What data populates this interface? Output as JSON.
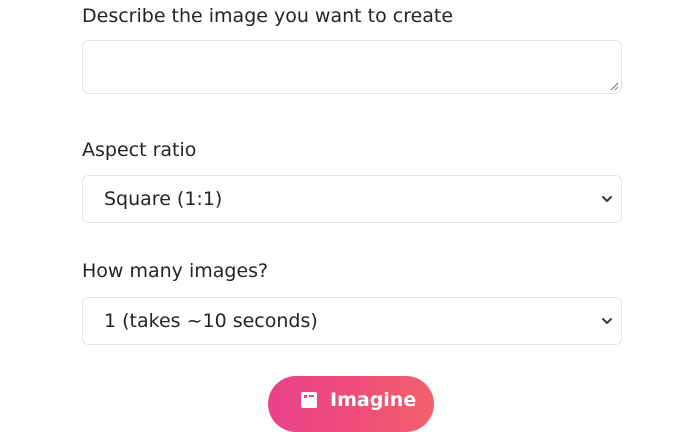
{
  "prompt": {
    "label": "Describe the image you want to create",
    "value": ""
  },
  "aspect_ratio": {
    "label": "Aspect ratio",
    "selected": "Square (1:1)"
  },
  "image_count": {
    "label": "How many images?",
    "selected": "1 (takes ~10 seconds)"
  },
  "generate_button": {
    "label": "Imagine",
    "icon": "image-icon"
  },
  "colors": {
    "button_gradient_start": "#e8418a",
    "button_gradient_end": "#f2606c",
    "border": "#dee2e6",
    "text": "#212529"
  }
}
